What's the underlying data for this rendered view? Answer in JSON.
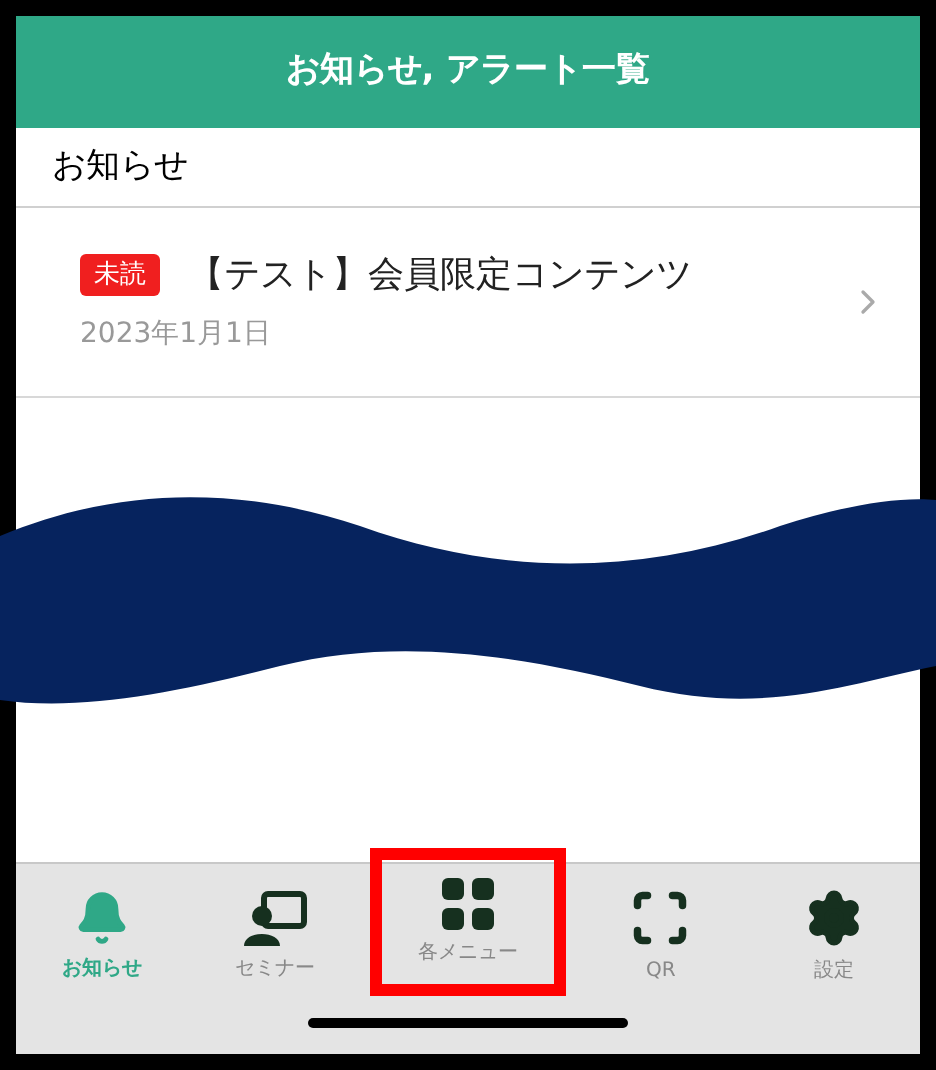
{
  "header": {
    "title": "お知らせ, アラート一覧"
  },
  "section": {
    "title": "お知らせ"
  },
  "notices": [
    {
      "badge": "未読",
      "unread": true,
      "title": "【テスト】会員限定コンテンツ",
      "date": "2023年1月1日"
    }
  ],
  "tabs": [
    {
      "kind": "bell",
      "label": "お知らせ",
      "selected": true,
      "highlighted": false
    },
    {
      "kind": "seminar",
      "label": "セミナー",
      "selected": false,
      "highlighted": false
    },
    {
      "kind": "grid",
      "label": "各メニュー",
      "selected": false,
      "highlighted": true
    },
    {
      "kind": "scan",
      "label": "QR",
      "selected": false,
      "highlighted": false
    },
    {
      "kind": "gear",
      "label": "設定",
      "selected": false,
      "highlighted": false
    }
  ]
}
